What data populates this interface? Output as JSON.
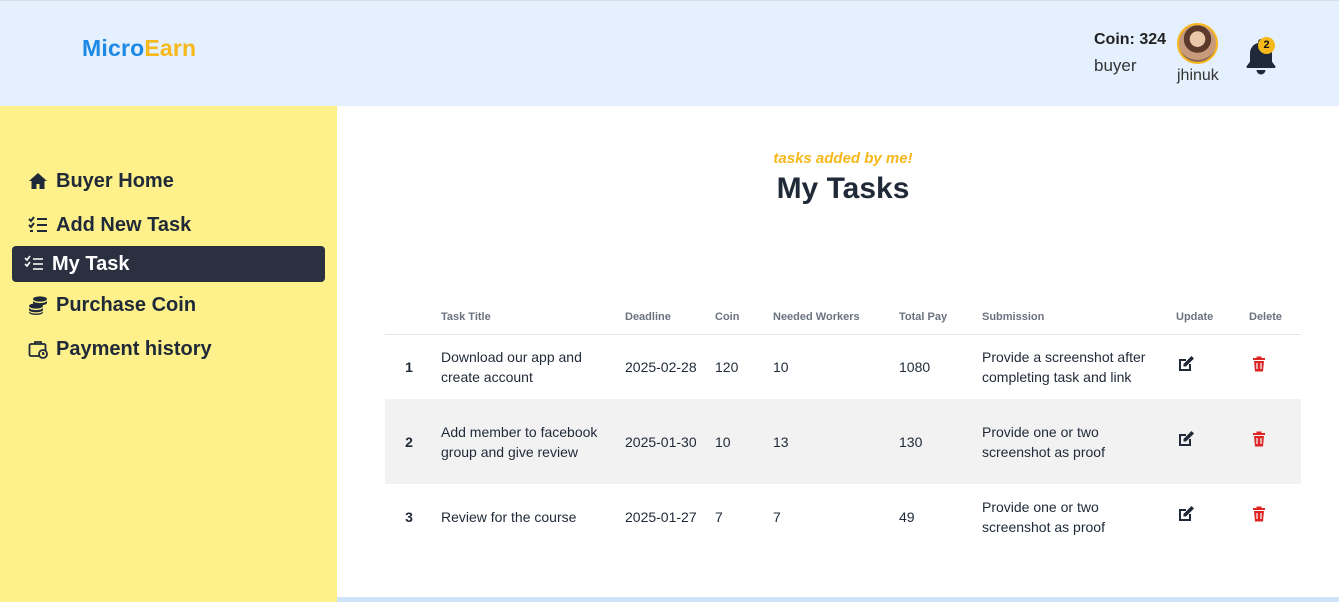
{
  "header": {
    "logo_part1": "Micro",
    "logo_part2": "Earn",
    "coin_label": "Coin: 324",
    "role": "buyer",
    "username": "jhinuk",
    "notification_count": "2"
  },
  "colors": {
    "accent_blue": "#1e88e5",
    "accent_yellow": "#f6b81a",
    "sidebar_bg": "#fef08a",
    "header_bg": "#e4f0fd",
    "active_nav_bg": "#2b3040",
    "delete_red": "#dc2626"
  },
  "sidebar": {
    "items": [
      {
        "label": "Buyer Home",
        "icon": "home-icon",
        "active": false
      },
      {
        "label": "Add New Task",
        "icon": "list-check-icon",
        "active": false
      },
      {
        "label": "My Task",
        "icon": "list-check-icon",
        "active": true
      },
      {
        "label": "Purchase Coin",
        "icon": "coins-icon",
        "active": false
      },
      {
        "label": "Payment history",
        "icon": "briefcase-clock-icon",
        "active": false
      }
    ]
  },
  "main": {
    "subtitle": "tasks added by me!",
    "title": "My Tasks"
  },
  "table": {
    "headers": [
      "",
      "Task Title",
      "Deadline",
      "Coin",
      "Needed Workers",
      "Total Pay",
      "Submission",
      "Update",
      "Delete"
    ],
    "rows": [
      {
        "num": "1",
        "title": "Download our app and create account",
        "deadline": "2025-02-28",
        "coin": "120",
        "workers": "10",
        "total": "1080",
        "submission": "Provide a screenshot after completing task and link"
      },
      {
        "num": "2",
        "title": "Add member to facebook group and give review",
        "deadline": "2025-01-30",
        "coin": "10",
        "workers": "13",
        "total": "130",
        "submission": "Provide one or two screenshot as proof"
      },
      {
        "num": "3",
        "title": "Review for the course",
        "deadline": "2025-01-27",
        "coin": "7",
        "workers": "7",
        "total": "49",
        "submission": "Provide one or two screenshot as proof"
      }
    ]
  }
}
